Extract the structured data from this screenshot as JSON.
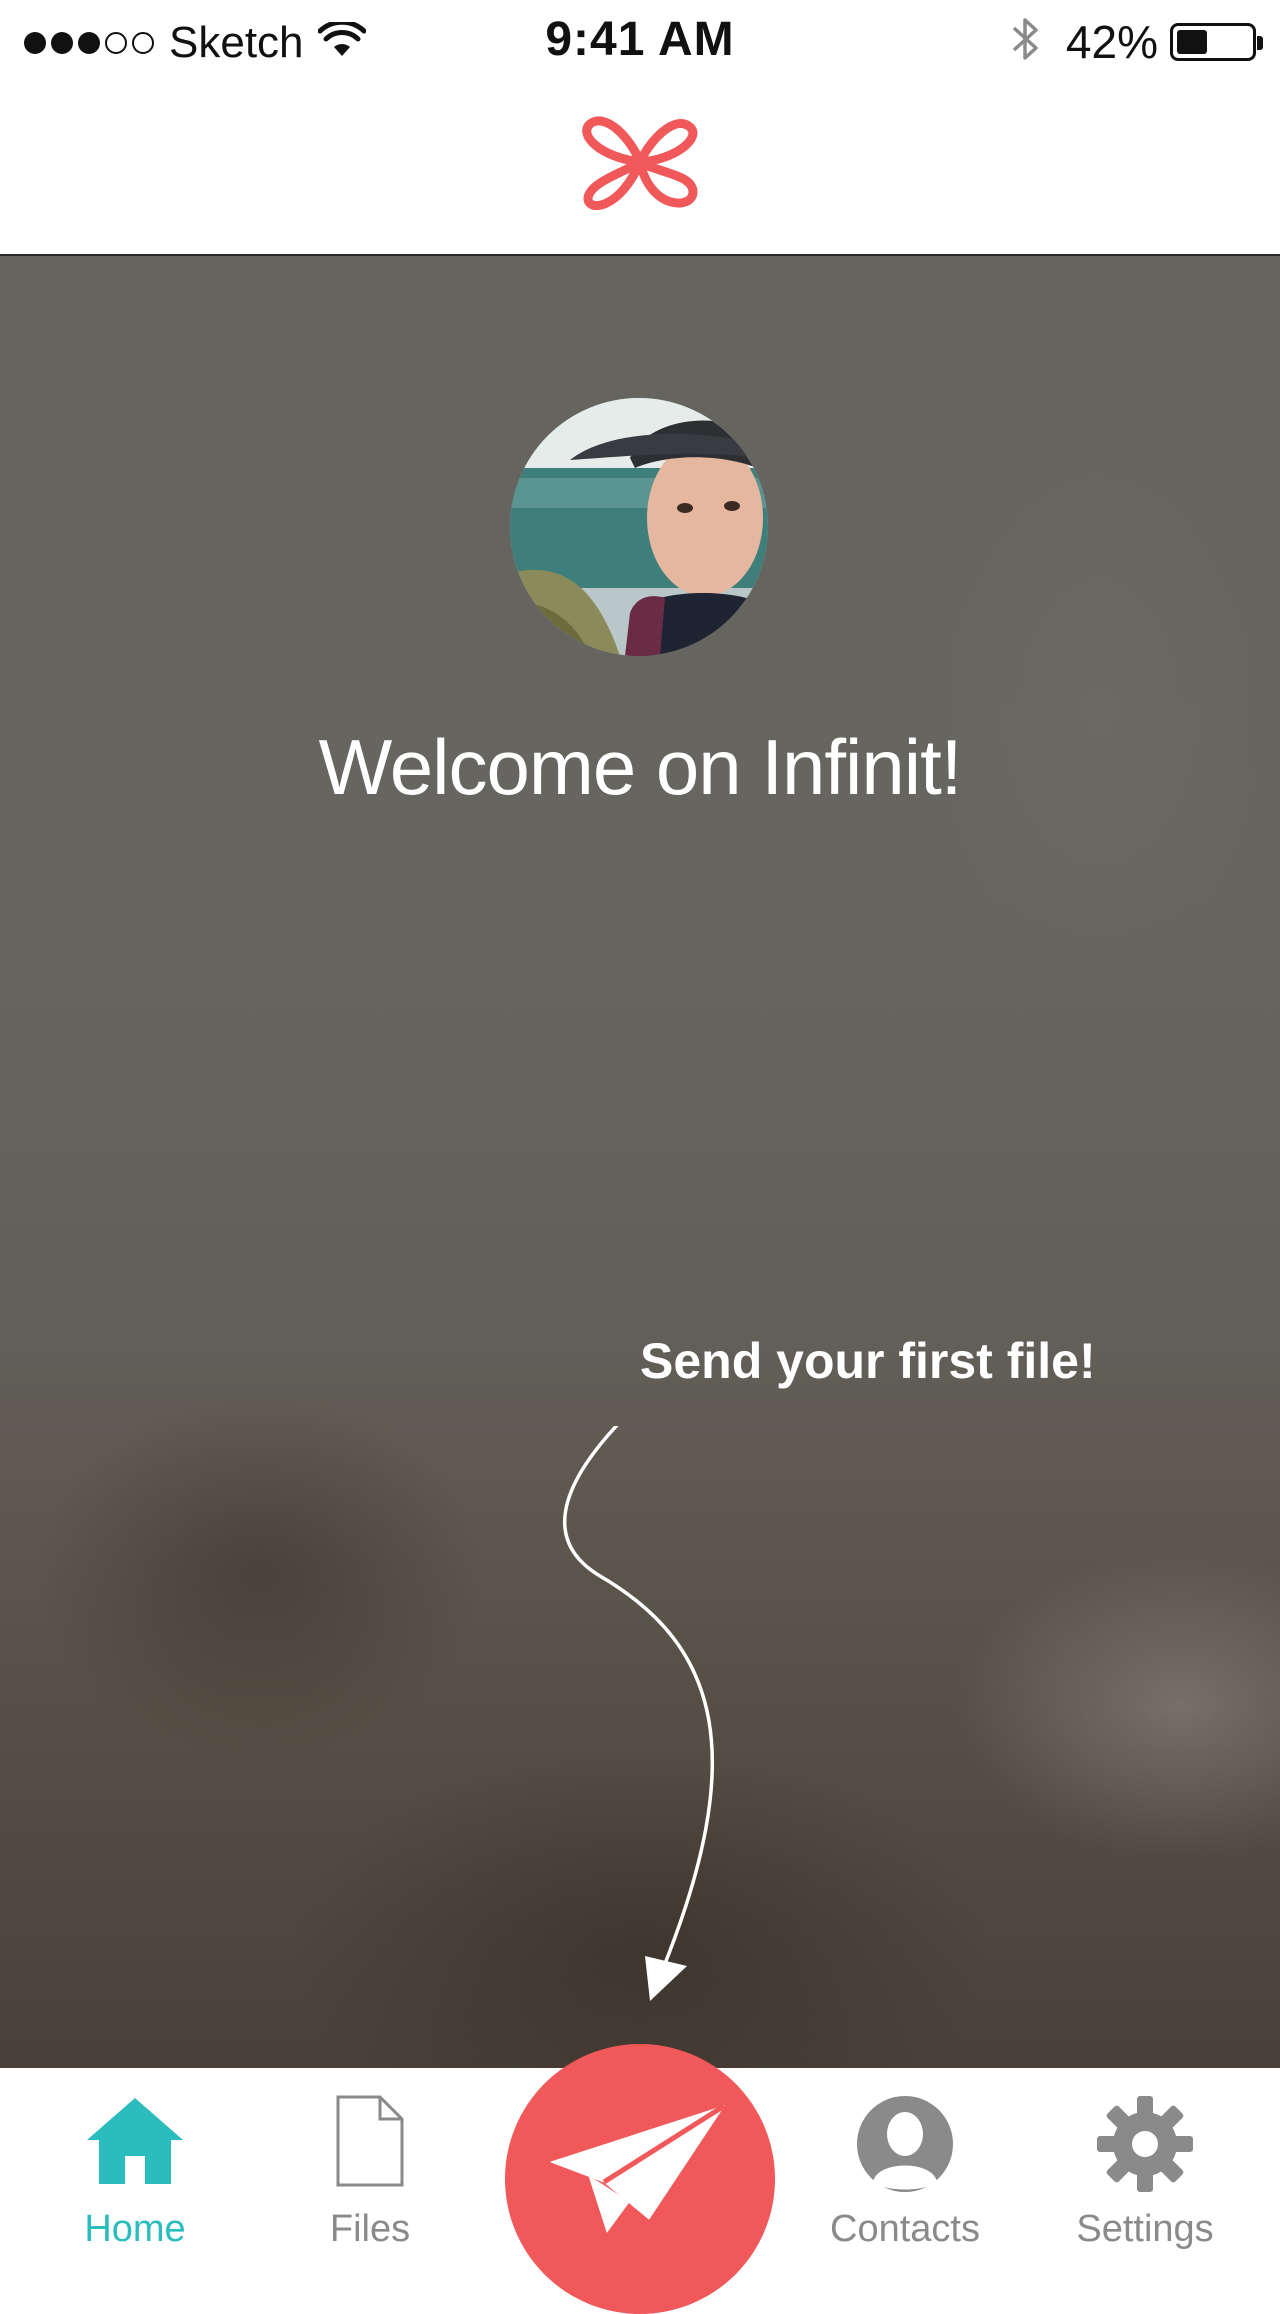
{
  "status_bar": {
    "carrier": "Sketch",
    "time": "9:41 AM",
    "battery_percent": "42%",
    "battery_level": 0.42,
    "signal_bars_filled": 3,
    "signal_bars_total": 5,
    "icons": [
      "wifi-icon",
      "bluetooth-icon",
      "battery-icon"
    ]
  },
  "nav": {
    "logo": "infinit-logo"
  },
  "colors": {
    "brand_red": "#f0585a",
    "active_teal": "#2bbcbe",
    "inactive_gray": "#8a8a8a"
  },
  "hero": {
    "welcome": "Welcome on Infinit!",
    "hint": "Send your first file!"
  },
  "tab_bar": {
    "home": "Home",
    "files": "Files",
    "contacts": "Contacts",
    "settings": "Settings",
    "active": "Home"
  }
}
